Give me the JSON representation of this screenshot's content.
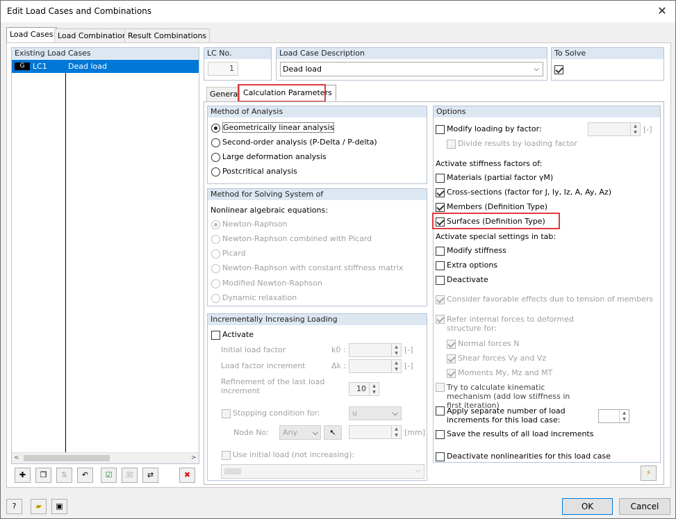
{
  "window": {
    "title": "Edit Load Cases and Combinations",
    "close": "✕"
  },
  "tabs": [
    "Load Cases",
    "Load Combinations",
    "Result Combinations"
  ],
  "existing": {
    "header": "Existing Load Cases",
    "rows": [
      {
        "badge": "G",
        "id": "LC1",
        "desc": "Dead load"
      }
    ]
  },
  "lc_no": {
    "label": "LC No.",
    "value": "1"
  },
  "lc_desc": {
    "label": "Load Case Description",
    "value": "Dead load"
  },
  "to_solve": {
    "label": "To Solve"
  },
  "subtabs": [
    "General",
    "Calculation Parameters"
  ],
  "method_analysis": {
    "header": "Method of Analysis",
    "options": [
      "Geometrically linear analysis",
      "Second-order analysis (P-Delta / P-delta)",
      "Large deformation analysis",
      "Postcritical analysis"
    ]
  },
  "method_solving": {
    "header": "Method for Solving System of",
    "subheader": "Nonlinear algebraic equations:",
    "options": [
      "Newton-Raphson",
      "Newton-Raphson combined with Picard",
      "Picard",
      "Newton-Raphson with constant stiffness matrix",
      "Modified Newton-Raphson",
      "Dynamic relaxation"
    ]
  },
  "incremental": {
    "header": "Incrementally Increasing Loading",
    "activate": "Activate",
    "initial": "Initial load factor",
    "initial_sym": "k0 :",
    "increment": "Load factor increment",
    "increment_sym": "Δk :",
    "unit": "[-]",
    "refinement": "Refinement of the last load increment",
    "refinement_value": "10",
    "stopping": "Stopping condition for:",
    "stopping_value": "u",
    "node": "Node No:",
    "node_value": "Any",
    "mm": "[mm]",
    "use_initial": "Use initial load (not increasing):"
  },
  "options": {
    "header": "Options",
    "modify_loading": "Modify loading by factor:",
    "unit": "[-]",
    "divide": "Divide results by loading factor",
    "activate_stiff": "Activate stiffness factors of:",
    "materials": "Materials (partial factor γM)",
    "cross_sections": "Cross-sections (factor for J, Iy, Iz, A, Ay, Az)",
    "members": "Members (Definition Type)",
    "surfaces": "Surfaces (Definition Type)",
    "special": "Activate special settings in tab:",
    "modify_stiff": "Modify stiffness",
    "extra": "Extra options",
    "deactivate": "Deactivate",
    "favorable": "Consider favorable effects due to tension of members",
    "refer": "Refer internal forces to deformed structure for:",
    "normal": "Normal forces N",
    "shear": "Shear forces Vy and Vz",
    "moments": "Moments My, Mz and MT",
    "kinematic": "Try to calculate kinematic mechanism (add low stiffness in first iteration)",
    "apply_sep": "Apply separate number of load increments for this load case:",
    "save_results": "Save the results of all load increments",
    "deactivate_nl": "Deactivate nonlinearities for this load case"
  },
  "footer": {
    "ok": "OK",
    "cancel": "Cancel"
  }
}
